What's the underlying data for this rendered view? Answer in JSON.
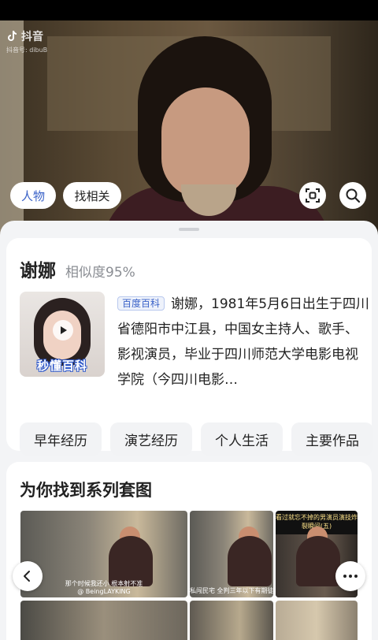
{
  "watermark": {
    "logo_text": "抖音",
    "account": "抖音号: dibuB"
  },
  "chips": {
    "person": "人物",
    "find_related": "找相关"
  },
  "icons": {
    "scan": "scan-icon",
    "search": "search-icon",
    "back": "chevron-left-icon",
    "more": "more-dots-icon"
  },
  "profile": {
    "name": "谢娜",
    "similarity": "相似度95%",
    "thumb_brand": "秒懂百科",
    "source_tag": "百度百科",
    "description": "谢娜，1981年5月6日出生于四川省德阳市中江县，中国女主持人、歌手、影视演员，毕业于四川师范大学电影电视学院（今四川电影…"
  },
  "tabs": [
    "早年经历",
    "演艺经历",
    "个人生活",
    "主要作品"
  ],
  "series": {
    "title": "为你找到系列套图",
    "captions": {
      "img1_bottom": "那个时候我还小  根本射不准",
      "img1_sub": "@ BeingLAYKING",
      "img2_bottom": "私闯民宅  全判三年以下有期徒刑",
      "img3_top": "看过就忘不掉的男演员演技炸裂瞬间(五)"
    }
  },
  "colors": {
    "accent": "#3a62c8",
    "sheet_bg": "#f3f4f6"
  }
}
